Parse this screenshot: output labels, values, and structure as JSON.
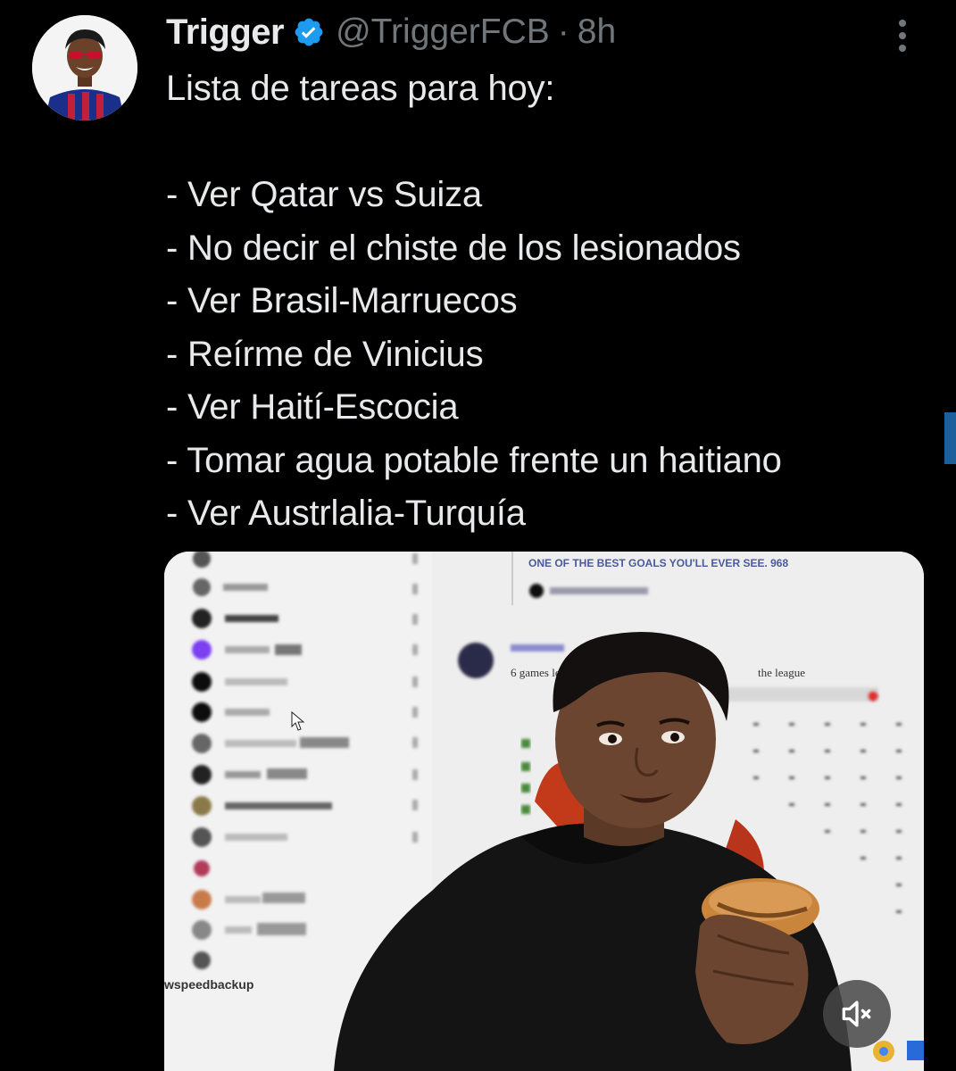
{
  "tweet": {
    "author": {
      "display_name": "Trigger",
      "handle": "@TriggerFCB",
      "verified": true,
      "avatar_icon": "profile-avatar"
    },
    "separator": "·",
    "timestamp": "8h",
    "more_icon": "more-options-icon",
    "text_lines": [
      "Lista de tareas para hoy:",
      "",
      "- Ver Qatar vs Suiza",
      "- No decir el chiste de los lesionados",
      "- Ver Brasil-Marruecos",
      "- Reírme de Vinicius",
      "- Ver Haití-Escocia",
      "- Tomar agua potable frente un haitiano",
      "- Ver Austrlalia-Turquía"
    ],
    "media": {
      "type": "video",
      "mute_icon": "volume-muted-icon",
      "overlay_texts": {
        "headline": "ONE OF THE BEST GOALS YOU'LL EVER SEE. 968",
        "chat_line": "6 games left",
        "chat_line_end": "the league",
        "channel": "wspeedbackup"
      }
    }
  },
  "colors": {
    "background": "#000000",
    "text_primary": "#e7e9ea",
    "text_secondary": "#71767b",
    "verified_blue": "#1d9bf0",
    "accent_scroll": "#1d5f9a"
  }
}
